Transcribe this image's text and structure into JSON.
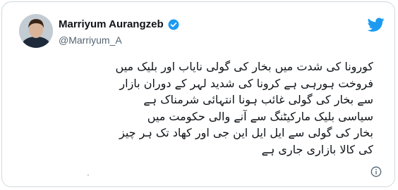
{
  "tweet": {
    "display_name": "Marriyum Aurangzeb",
    "handle": "@Marriyum_A",
    "text_lines": [
      "کورونا کی شدت میں بخار کی گولی نایاب اور بلیک میں",
      "فروخت ہورہی ہے کرونا کی شدید لہر کے دوران بازار",
      "سے بخار کی گولی غائب ہونا انتہائی شرمناک ہے",
      "سیاسی بلیک مارکیٹنگ سے آنے والی حکومت میں",
      "بخار کی گولی سے ایل ایل این جی اور کھاد تک ہر چیز",
      "کی کالا بازاری جاری ہے"
    ]
  },
  "icons": {
    "verified": "verified-badge-icon",
    "twitter": "twitter-bird-icon",
    "info": "info-icon"
  },
  "colors": {
    "twitter_blue": "#1d9bf0",
    "text": "#0f1419",
    "secondary_text": "#536471",
    "border": "#cfd9de"
  }
}
